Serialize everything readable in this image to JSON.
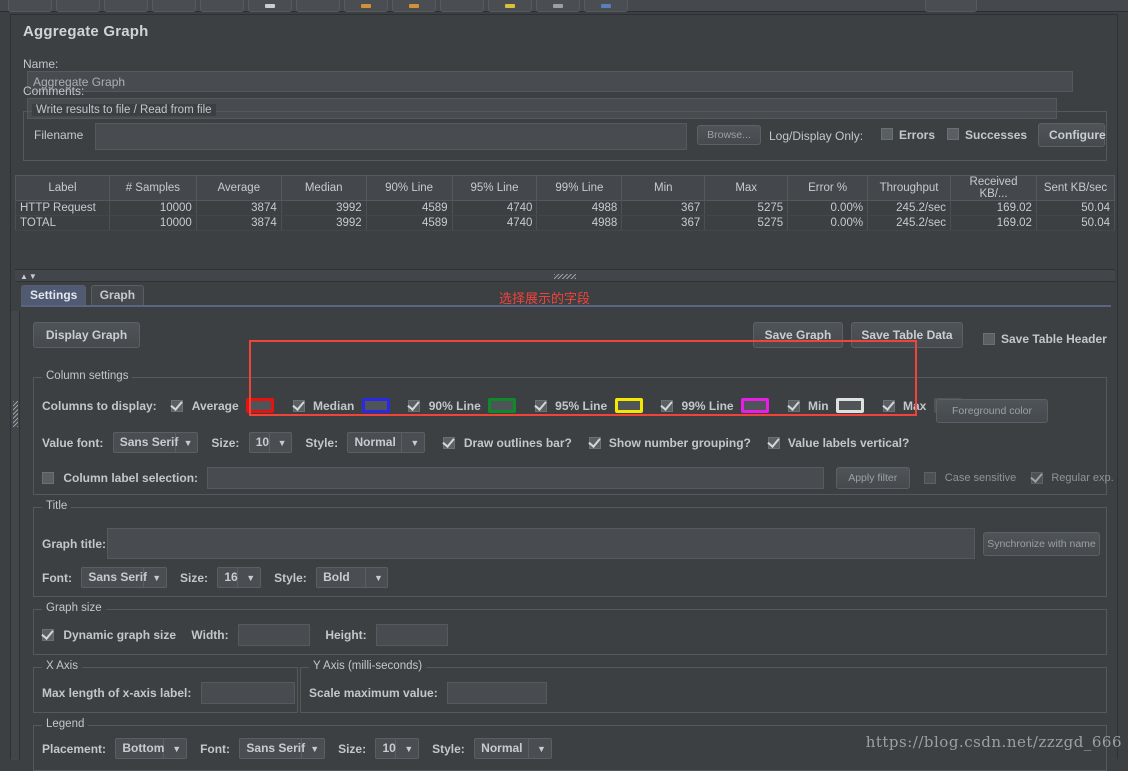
{
  "toolbar": {
    "buttons": [
      {
        "name": "new",
        "dot": ""
      },
      {
        "name": "templates",
        "dot": ""
      },
      {
        "name": "open",
        "dot": ""
      },
      {
        "name": "close",
        "dot": ""
      },
      {
        "name": "save",
        "dot": ""
      },
      {
        "name": "save-as",
        "dot": "#c9ced3"
      },
      {
        "name": "cut",
        "dot": ""
      },
      {
        "name": "copy",
        "dot": "#d2903a"
      },
      {
        "name": "paste",
        "dot": "#d2903a"
      },
      {
        "name": "expand",
        "dot": ""
      },
      {
        "name": "collapse",
        "dot": "#d8c038"
      },
      {
        "name": "toggle",
        "dot": "#9aa0a5"
      },
      {
        "name": "start",
        "dot": "#5a7fb8"
      }
    ]
  },
  "page": {
    "title": "Aggregate Graph"
  },
  "name_field": {
    "label": "Name:",
    "value": "Aggregate Graph"
  },
  "comments_field": {
    "label": "Comments:",
    "value": ""
  },
  "write_results": {
    "group_title": "Write results to file / Read from file",
    "filename_label": "Filename",
    "filename_value": "",
    "browse_label": "Browse...",
    "log_display_label": "Log/Display Only:",
    "errors_label": "Errors",
    "errors_checked": false,
    "successes_label": "Successes",
    "successes_checked": false,
    "configure_label": "Configure"
  },
  "table": {
    "headers": [
      "Label",
      "# Samples",
      "Average",
      "Median",
      "90% Line",
      "95% Line",
      "99% Line",
      "Min",
      "Max",
      "Error %",
      "Throughput",
      "Received KB/...",
      "Sent KB/sec"
    ],
    "rows": [
      [
        "HTTP Request",
        "10000",
        "3874",
        "3992",
        "4589",
        "4740",
        "4988",
        "367",
        "5275",
        "0.00%",
        "245.2/sec",
        "169.02",
        "50.04"
      ],
      [
        "TOTAL",
        "10000",
        "3874",
        "3992",
        "4589",
        "4740",
        "4988",
        "367",
        "5275",
        "0.00%",
        "245.2/sec",
        "169.02",
        "50.04"
      ]
    ]
  },
  "tabs": [
    {
      "label": "Settings",
      "active": true
    },
    {
      "label": "Graph",
      "active": false
    }
  ],
  "annotation": {
    "text": "选择展示的字段",
    "color": "#f0443a"
  },
  "actions": {
    "display_graph": "Display Graph",
    "save_graph": "Save Graph",
    "save_table_data": "Save Table Data",
    "save_table_header": "Save Table Header",
    "save_table_header_checked": false
  },
  "column_settings": {
    "group_title": "Column settings",
    "columns_label": "Columns to display:",
    "columns": [
      {
        "label": "Average",
        "checked": true,
        "color": "#e8120c"
      },
      {
        "label": "Median",
        "checked": true,
        "color": "#2a2ae0"
      },
      {
        "label": "90% Line",
        "checked": true,
        "color": "#0f8a2a"
      },
      {
        "label": "95% Line",
        "checked": true,
        "color": "#f5e800"
      },
      {
        "label": "99% Line",
        "checked": true,
        "color": "#e81de8"
      },
      {
        "label": "Min",
        "checked": true,
        "color": "#e0e0e0"
      },
      {
        "label": "Max",
        "checked": true,
        "color": "#4f5458"
      }
    ],
    "foreground_color_label": "Foreground color",
    "value_font_label": "Value font:",
    "value_font": "Sans Serif",
    "size_label": "Size:",
    "value_size": "10",
    "style_label": "Style:",
    "value_style": "Normal",
    "draw_outlines_label": "Draw outlines bar?",
    "draw_outlines_checked": true,
    "number_grouping_label": "Show number grouping?",
    "number_grouping_checked": true,
    "labels_vertical_label": "Value labels vertical?",
    "labels_vertical_checked": true,
    "column_label_selection": "Column label selection:",
    "column_label_selection_checked": false,
    "column_label_value": "",
    "apply_filter_label": "Apply filter",
    "case_sensitive_label": "Case sensitive",
    "case_sensitive_checked": false,
    "regular_exp_label": "Regular exp.",
    "regular_exp_checked": true
  },
  "title_section": {
    "group_title": "Title",
    "graph_title_label": "Graph title:",
    "graph_title_value": "",
    "synchronize_label": "Synchronize with name",
    "font_label": "Font:",
    "font": "Sans Serif",
    "size_label": "Size:",
    "size": "16",
    "style_label": "Style:",
    "style": "Bold"
  },
  "graph_size": {
    "group_title": "Graph size",
    "dynamic_label": "Dynamic graph size",
    "dynamic_checked": true,
    "width_label": "Width:",
    "width_value": "",
    "height_label": "Height:",
    "height_value": ""
  },
  "x_axis": {
    "group_title": "X Axis",
    "max_length_label": "Max length of x-axis label:",
    "max_length_value": ""
  },
  "y_axis": {
    "group_title": "Y Axis (milli-seconds)",
    "scale_max_label": "Scale maximum value:",
    "scale_max_value": ""
  },
  "legend": {
    "group_title": "Legend",
    "placement_label": "Placement:",
    "placement": "Bottom",
    "font_label": "Font:",
    "font": "Sans Serif",
    "size_label": "Size:",
    "size": "10",
    "style_label": "Style:",
    "style": "Normal"
  },
  "watermark": {
    "text": "https://blog.csdn.net/zzzgd_666"
  }
}
